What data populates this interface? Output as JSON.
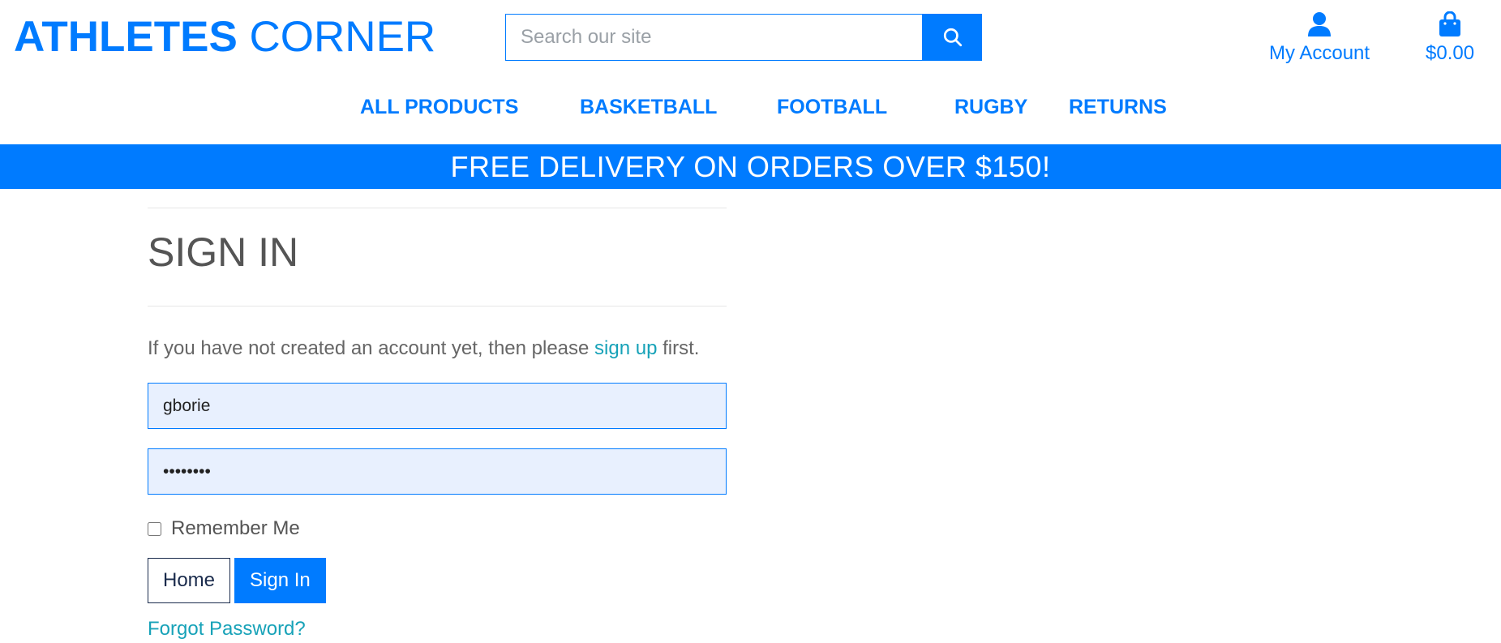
{
  "brand": {
    "part1": "ATHLETES",
    "part2": "CORNER"
  },
  "search": {
    "placeholder": "Search our site",
    "icon": "search-icon"
  },
  "header": {
    "account_label": "My Account",
    "account_icon": "user-icon",
    "bag_total": "$0.00",
    "bag_icon": "shopping-bag-icon"
  },
  "nav": {
    "items": [
      {
        "label": "ALL PRODUCTS"
      },
      {
        "label": "BASKETBALL"
      },
      {
        "label": "FOOTBALL"
      },
      {
        "label": "RUGBY"
      },
      {
        "label": "RETURNS"
      }
    ]
  },
  "banner": {
    "text": "FREE DELIVERY ON ORDERS OVER $150!"
  },
  "signin": {
    "title": "SIGN IN",
    "intro_before": "If you have not created an account yet, then please ",
    "intro_link": "sign up",
    "intro_after": " first.",
    "username_value": "gborie",
    "password_value": "••••••••",
    "remember_label": "Remember Me",
    "home_button": "Home",
    "signin_button": "Sign In",
    "forgot_link": "Forgot Password?"
  },
  "colors": {
    "accent": "#007bff",
    "link": "#17a2b8",
    "input_bg": "#e8f0fe"
  }
}
